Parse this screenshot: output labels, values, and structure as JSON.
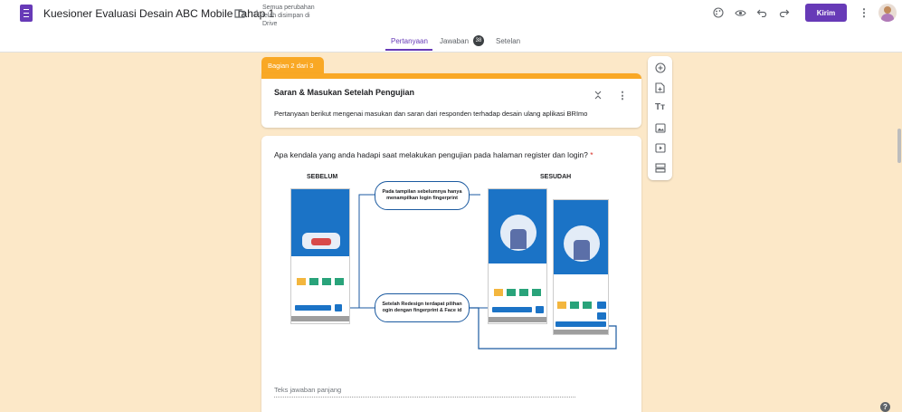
{
  "header": {
    "doc_title": "Kuesioner Evaluasi Desain ABC Mobile Tahap 1",
    "save_status": "Semua perubahan telah disimpan di Drive",
    "send_label": "Kirim"
  },
  "tabs": [
    {
      "label": "Pertanyaan",
      "active": true
    },
    {
      "label": "Jawaban",
      "badge": "38"
    },
    {
      "label": "Setelan"
    }
  ],
  "section": {
    "tag": "Bagian 2 dari 3",
    "title": "Saran & Masukan Setelah Pengujian",
    "description": "Pertanyaan berikut mengenai masukan dan saran dari responden terhadap desain ulang aplikasi BRImo"
  },
  "question": {
    "text": "Apa kendala yang anda hadapi saat melakukan pengujian pada halaman register dan login?",
    "required_mark": "*",
    "answer_placeholder": "Teks jawaban panjang"
  },
  "illustration": {
    "before_label": "SEBELUM",
    "after_label": "SESUDAH",
    "callout_1": "Pada tampilan sebelumnya hanya menampilkan login fingerprint",
    "callout_2": "Setelah Redesign terdapat pilihan ogin dengan fingerprint & Face id"
  },
  "colors": {
    "accent": "#673ab7",
    "section": "#f9a825",
    "background": "#fce8c8",
    "phone_blue": "#1b73c6"
  },
  "help_label": "?"
}
